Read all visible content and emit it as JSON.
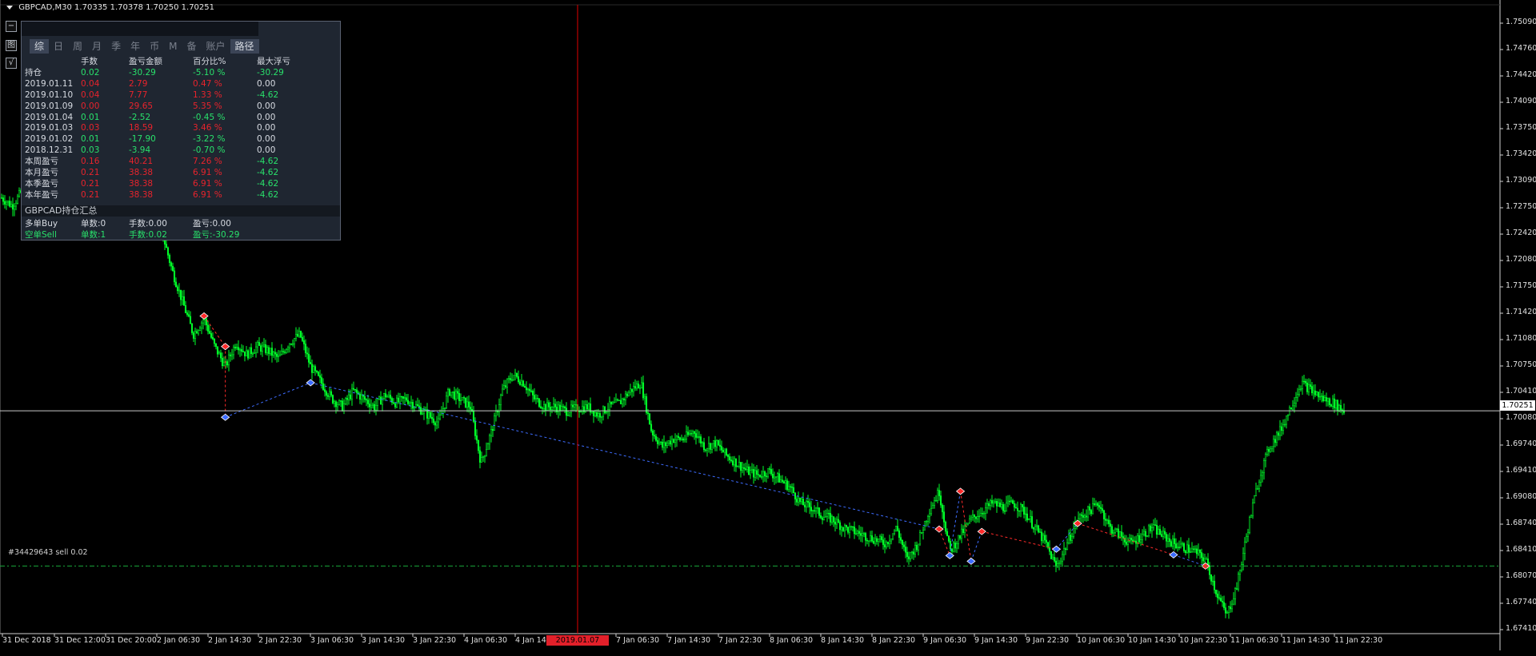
{
  "header": {
    "symbol_info": "GBPCAD,M30  1.70335 1.70378 1.70250 1.70251"
  },
  "colors": {
    "background": "#000000",
    "candle": "#00ff2a",
    "grid_axis": "#ffffff",
    "crosshair": "#e00000",
    "buy_marker": "#3d6cff",
    "sell_marker": "#ff2a2a",
    "panel_bg": "#1f2631",
    "positive": "#29e06b",
    "negative": "#e8232c"
  },
  "side_buttons": [
    "−",
    "图",
    "√"
  ],
  "panel": {
    "tabs": [
      "综",
      "日",
      "周",
      "月",
      "季",
      "年",
      "币",
      "M",
      "备",
      "账户",
      "路径"
    ],
    "columns": [
      "",
      "手数",
      "盈亏金额",
      "百分比%",
      "最大浮亏"
    ],
    "rows": [
      {
        "label": "持仓",
        "lots": "0.02",
        "pnl": "-30.29",
        "pct": "-5.10 %",
        "maxdd": "-30.29",
        "tone": "g"
      },
      {
        "label": "2019.01.11",
        "lots": "0.04",
        "pnl": "2.79",
        "pct": "0.47 %",
        "maxdd": "0.00",
        "tone": "r"
      },
      {
        "label": "2019.01.10",
        "lots": "0.04",
        "pnl": "7.77",
        "pct": "1.33 %",
        "maxdd": "-4.62",
        "tone": "r"
      },
      {
        "label": "2019.01.09",
        "lots": "0.00",
        "pnl": "29.65",
        "pct": "5.35 %",
        "maxdd": "0.00",
        "tone": "r"
      },
      {
        "label": "2019.01.04",
        "lots": "0.01",
        "pnl": "-2.52",
        "pct": "-0.45 %",
        "maxdd": "0.00",
        "tone": "g"
      },
      {
        "label": "2019.01.03",
        "lots": "0.03",
        "pnl": "18.59",
        "pct": "3.46 %",
        "maxdd": "0.00",
        "tone": "r"
      },
      {
        "label": "2019.01.02",
        "lots": "0.01",
        "pnl": "-17.90",
        "pct": "-3.22 %",
        "maxdd": "0.00",
        "tone": "g"
      },
      {
        "label": "2018.12.31",
        "lots": "0.03",
        "pnl": "-3.94",
        "pct": "-0.70 %",
        "maxdd": "0.00",
        "tone": "g"
      },
      {
        "label": "本周盈亏",
        "lots": "0.16",
        "pnl": "40.21",
        "pct": "7.26 %",
        "maxdd": "-4.62",
        "tone": "r"
      },
      {
        "label": "本月盈亏",
        "lots": "0.21",
        "pnl": "38.38",
        "pct": "6.91 %",
        "maxdd": "-4.62",
        "tone": "r"
      },
      {
        "label": "本季盈亏",
        "lots": "0.21",
        "pnl": "38.38",
        "pct": "6.91 %",
        "maxdd": "-4.62",
        "tone": "r"
      },
      {
        "label": "本年盈亏",
        "lots": "0.21",
        "pnl": "38.38",
        "pct": "6.91 %",
        "maxdd": "-4.62",
        "tone": "r"
      }
    ],
    "summary_title": "GBPCAD持仓汇总",
    "summary_rows": [
      {
        "side": "多单Buy",
        "count": "单数:0",
        "lots": "手数:0.00",
        "pnl": "盈亏:0.00",
        "tone": "w"
      },
      {
        "side": "空单Sell",
        "count": "单数:1",
        "lots": "手数:0.02",
        "pnl": "盈亏:-30.29",
        "tone": "g"
      }
    ]
  },
  "order_line_label": "#34429643 sell 0.02",
  "price_axis": {
    "labels": [
      "1.75090",
      "1.74760",
      "1.74420",
      "1.74090",
      "1.73750",
      "1.73420",
      "1.73090",
      "1.72750",
      "1.72420",
      "1.72080",
      "1.71750",
      "1.71420",
      "1.71080",
      "1.70750",
      "1.70410",
      "1.70080",
      "1.69740",
      "1.69410",
      "1.69080",
      "1.68740",
      "1.68410",
      "1.68070",
      "1.67740",
      "1.67410"
    ],
    "current_price": "1.70251"
  },
  "time_axis": {
    "labels": [
      "31 Dec 2018",
      "31 Dec 12:00",
      "31 Dec 20:00",
      "2 Jan 06:30",
      "2 Jan 14:30",
      "2 Jan 22:30",
      "3 Jan 06:30",
      "3 Jan 14:30",
      "3 Jan 22:30",
      "4 Jan 06:30",
      "4 Jan 14:30",
      "7 Jan 06:30",
      "7 Jan 14:30",
      "7 Jan 22:30",
      "8 Jan 06:30",
      "8 Jan 14:30",
      "8 Jan 22:30",
      "9 Jan 06:30",
      "9 Jan 14:30",
      "9 Jan 22:30",
      "10 Jan 06:30",
      "10 Jan 14:30",
      "10 Jan 22:30",
      "11 Jan 06:30",
      "11 Jan 14:30",
      "11 Jan 22:30"
    ],
    "cursor_time": "2019.01.07 00:00"
  },
  "chart_data": {
    "type": "candlestick",
    "symbol": "GBPCAD",
    "timeframe": "M30",
    "ylim": [
      1.6741,
      1.7526
    ],
    "current_price": 1.70251,
    "sell_order_price": 1.6832,
    "path_close": [
      1.729,
      1.728,
      1.73,
      1.731,
      1.733,
      1.735,
      1.737,
      1.739,
      1.742,
      1.744,
      1.745,
      1.743,
      1.74,
      1.735,
      1.73,
      1.725,
      1.72,
      1.716,
      1.712,
      1.714,
      1.7105,
      1.708,
      1.711,
      1.7095,
      1.7105,
      1.71,
      1.709,
      1.711,
      1.712,
      1.708,
      1.706,
      1.704,
      1.703,
      1.705,
      1.704,
      1.703,
      1.7045,
      1.7035,
      1.704,
      1.703,
      1.702,
      1.701,
      1.705,
      1.704,
      1.703,
      1.696,
      1.7,
      1.705,
      1.707,
      1.706,
      1.704,
      1.703,
      1.703,
      1.7025,
      1.7028,
      1.703,
      1.702,
      1.703,
      1.7035,
      1.705,
      1.706,
      1.7,
      1.698,
      1.699,
      1.699,
      1.7,
      1.698,
      1.6985,
      1.697,
      1.696,
      1.695,
      1.6945,
      1.695,
      1.694,
      1.693,
      1.691,
      1.6905,
      1.6895,
      1.689,
      1.688,
      1.6875,
      1.687,
      1.6865,
      1.686,
      1.688,
      1.684,
      1.686,
      1.69,
      1.6925,
      1.685,
      1.687,
      1.689,
      1.69,
      1.691,
      1.6905,
      1.691,
      1.69,
      1.688,
      1.686,
      1.683,
      1.686,
      1.689,
      1.69,
      1.691,
      1.688,
      1.687,
      1.686,
      1.687,
      1.688,
      1.687,
      1.686,
      1.6855,
      1.685,
      1.684,
      1.68,
      1.677,
      1.681,
      1.688,
      1.694,
      1.698,
      1.7,
      1.703,
      1.706,
      1.705,
      1.704,
      1.7035,
      1.7025
    ],
    "trade_markers": [
      {
        "index": 19,
        "price": 1.7143,
        "side": "sell"
      },
      {
        "index": 21,
        "price": 1.7105,
        "side": "sell"
      },
      {
        "index": 21,
        "price": 1.7017,
        "side": "buy"
      },
      {
        "index": 29,
        "price": 1.706,
        "side": "buy"
      },
      {
        "index": 88,
        "price": 1.6878,
        "side": "sell"
      },
      {
        "index": 89,
        "price": 1.6845,
        "side": "buy"
      },
      {
        "index": 90,
        "price": 1.6925,
        "side": "sell"
      },
      {
        "index": 91,
        "price": 1.6838,
        "side": "buy"
      },
      {
        "index": 92,
        "price": 1.6875,
        "side": "sell"
      },
      {
        "index": 99,
        "price": 1.6853,
        "side": "buy"
      },
      {
        "index": 101,
        "price": 1.6885,
        "side": "sell"
      },
      {
        "index": 110,
        "price": 1.6846,
        "side": "buy"
      },
      {
        "index": 113,
        "price": 1.6832,
        "side": "sell"
      }
    ]
  }
}
